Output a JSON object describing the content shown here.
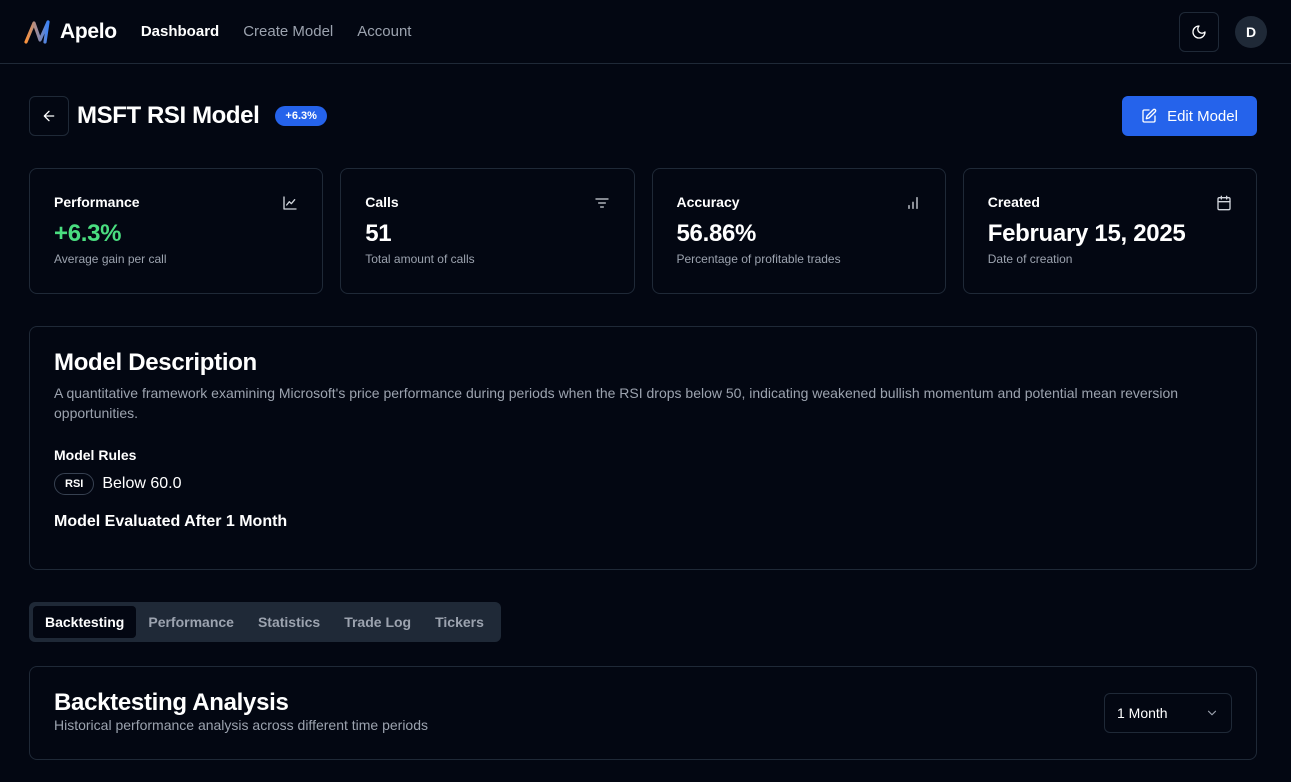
{
  "app": {
    "name": "Apelo",
    "user_initial": "D"
  },
  "nav": {
    "links": [
      "Dashboard",
      "Create Model",
      "Account"
    ],
    "active": "Dashboard"
  },
  "header": {
    "title": "MSFT RSI Model",
    "badge": "+6.3%",
    "edit_label": "Edit Model"
  },
  "stats": [
    {
      "label": "Performance",
      "value": "+6.3%",
      "sub": "Average gain per call",
      "icon": "line-chart-icon"
    },
    {
      "label": "Calls",
      "value": "51",
      "sub": "Total amount of calls",
      "icon": "filter-icon"
    },
    {
      "label": "Accuracy",
      "value": "56.86%",
      "sub": "Percentage of profitable trades",
      "icon": "bar-chart-icon"
    },
    {
      "label": "Created",
      "value": "February 15, 2025",
      "sub": "Date of creation",
      "icon": "calendar-icon"
    }
  ],
  "description": {
    "title": "Model Description",
    "text": "A quantitative framework examining Microsoft's price performance during periods when the RSI drops below 50, indicating weakened bullish momentum and potential mean reversion opportunities.",
    "rules_title": "Model Rules",
    "rule_chip": "RSI",
    "rule_text": "Below 60.0",
    "evaluation": "Model Evaluated After 1 Month"
  },
  "tabs": {
    "items": [
      "Backtesting",
      "Performance",
      "Statistics",
      "Trade Log",
      "Tickers"
    ],
    "active": 0
  },
  "backtesting": {
    "title": "Backtesting Analysis",
    "subtitle": "Historical performance analysis across different time periods",
    "period": "1 Month"
  },
  "colors": {
    "background": "#030712",
    "accent": "#2563eb",
    "positive": "#4ade80",
    "border": "#1f2937"
  }
}
